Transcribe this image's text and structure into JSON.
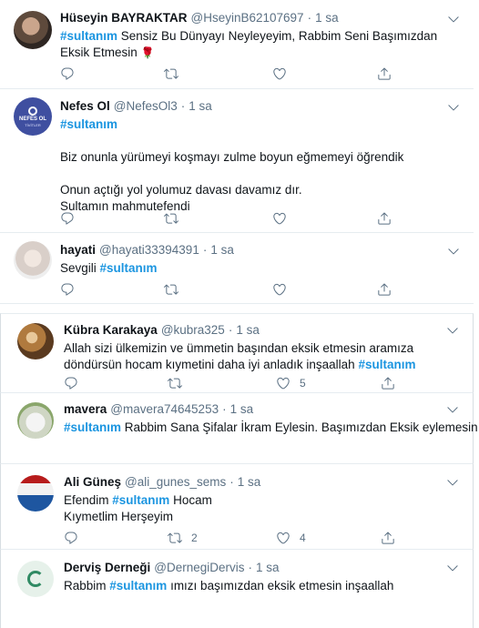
{
  "tweets": [
    {
      "name": "Hüseyin BAYRAKTAR",
      "handle": "@HseyinB62107697",
      "dot": "·",
      "time": "1 sa",
      "hashtag": "#sultanım",
      "text_after": " Sensiz Bu Dünyayı Neyleyeyim, Rabbim Seni Başımızdan Eksik Etmesin",
      "emoji": "🌹",
      "reply_count": "",
      "retweet_count": "",
      "like_count": ""
    },
    {
      "name": "Nefes Ol",
      "handle": "@NefesOl3",
      "dot": "·",
      "time": "1 sa",
      "hashtag": "#sultanım",
      "line1": "Biz onunla yürümeyi koşmayı zulme boyun eğmemeyi öğrendik",
      "line2": "Onun açtığı yol yolumuz davası davamız dır.",
      "line3": "Sultamın mahmutefendi",
      "avatar_text_top": "NEFES OL",
      "avatar_text_bottom": "TİVİTLER"
    },
    {
      "name": "hayati",
      "handle": "@hayati33394391",
      "dot": "·",
      "time": "1 sa",
      "text_before": "Sevgili ",
      "hashtag": "#sultanım"
    },
    {
      "name": "Kübra Karakaya",
      "handle": "@kubra325",
      "dot": "·",
      "time": "1 sa",
      "text_before": "Allah sizi ülkemizin ve ümmetin başından eksik etmesin aramıza döndürsün hocam kıymetini daha iyi anladık inşaallah ",
      "hashtag": "#sultanım",
      "like_count": "5"
    },
    {
      "name": "mavera",
      "handle": "@mavera74645253",
      "dot": "·",
      "time": "1 sa",
      "hashtag": "#sultanım",
      "text_after": " Rabbim Sana Şifalar İkram Eylesin. Başımızdan Eksik eylemesin"
    },
    {
      "name": "Ali Güneş",
      "handle": "@ali_gunes_sems",
      "dot": "·",
      "time": "1 sa",
      "text_before": "Efendim ",
      "hashtag": "#sultanım",
      "text_after": " Hocam",
      "line2": "Kıymetlim Herşeyim",
      "retweet_count": "2",
      "like_count": "4"
    },
    {
      "name": "Derviş Derneği",
      "handle": "@DernegiDervis",
      "dot": "·",
      "time": "1 sa",
      "text_before": "Rabbim ",
      "hashtag": "#sultanım",
      "text_after": " ımızı başımızdan eksik etmesin inşaallah"
    }
  ],
  "colors": {
    "hashtag": "#1b95e0",
    "secondary_text": "#5b7083",
    "divider": "#e6ecf0"
  }
}
